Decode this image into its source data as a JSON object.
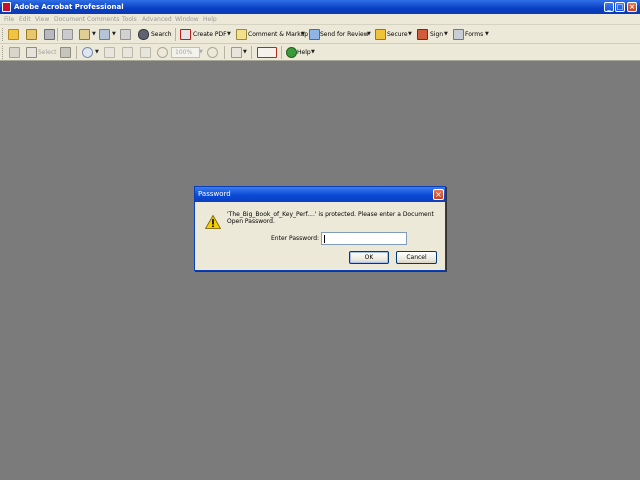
{
  "window": {
    "title": "Adobe Acrobat Professional"
  },
  "menu": [
    "File",
    "Edit",
    "View",
    "Document",
    "Comments",
    "Tools",
    "Advanced",
    "Window",
    "Help"
  ],
  "toolbar1": {
    "search_label": "Search",
    "create_pdf_label": "Create PDF",
    "comment_label": "Comment & Markup",
    "review_label": "Send for Review",
    "secure_label": "Secure",
    "sign_label": "Sign",
    "forms_label": "Forms"
  },
  "toolbar2": {
    "select_label": "Select",
    "zoom_value": "100%",
    "help_label": "Help"
  },
  "dialog": {
    "title": "Password",
    "message": "'The_Big_Book_of_Key_Perf....' is protected. Please enter a Document Open Password.",
    "password_label": "Enter Password:",
    "password_value": "",
    "ok_label": "OK",
    "cancel_label": "Cancel"
  },
  "colors": {
    "workspace": "#7b7b7b",
    "titlebar": "#0a49d6",
    "chrome": "#ece9d8"
  }
}
